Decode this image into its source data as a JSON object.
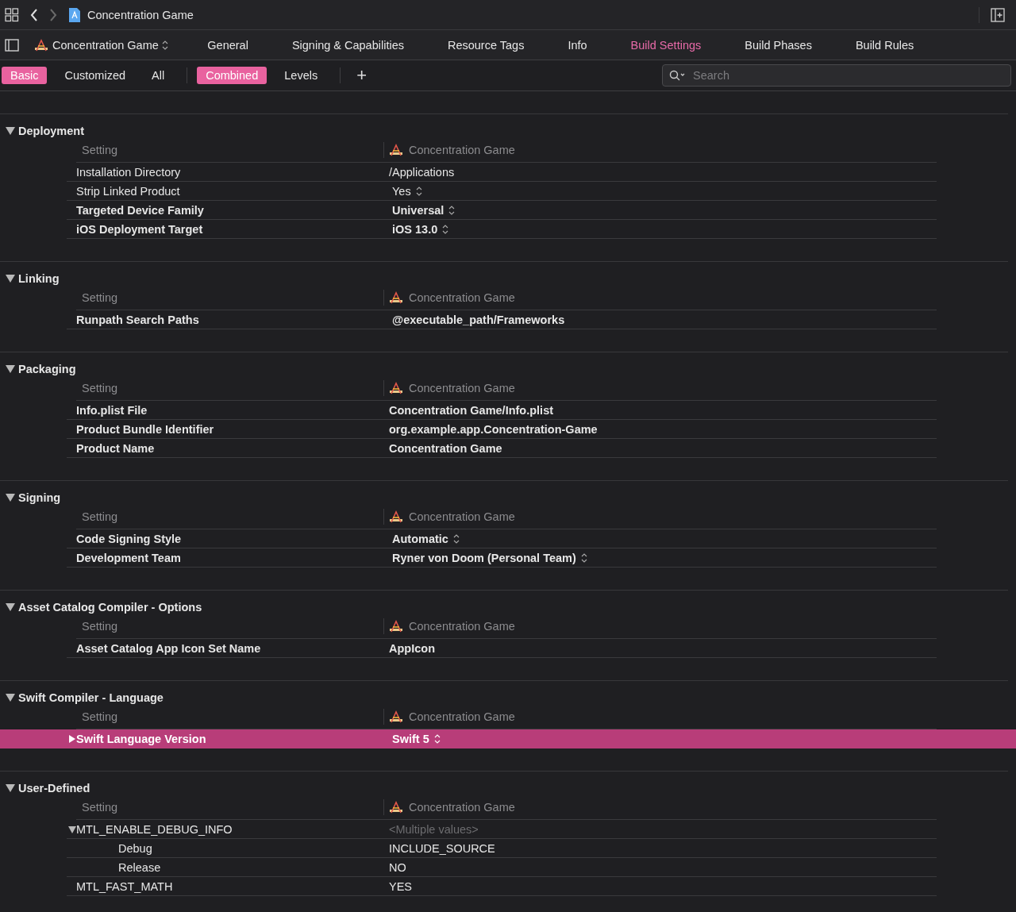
{
  "toolbar": {
    "title": "Concentration Game"
  },
  "editor_tabs": {
    "target": "Concentration Game",
    "tabs": [
      {
        "label": "General",
        "selected": false
      },
      {
        "label": "Signing & Capabilities",
        "selected": false
      },
      {
        "label": "Resource Tags",
        "selected": false
      },
      {
        "label": "Info",
        "selected": false
      },
      {
        "label": "Build Settings",
        "selected": true
      },
      {
        "label": "Build Phases",
        "selected": false
      },
      {
        "label": "Build Rules",
        "selected": false
      }
    ]
  },
  "filter_bar": {
    "scope": [
      {
        "label": "Basic",
        "selected": true
      },
      {
        "label": "Customized",
        "selected": false
      },
      {
        "label": "All",
        "selected": false
      }
    ],
    "view": [
      {
        "label": "Combined",
        "selected": true
      },
      {
        "label": "Levels",
        "selected": false
      }
    ],
    "add": "+",
    "search": {
      "placeholder": "Search"
    }
  },
  "sections": [
    {
      "title": "Deployment",
      "expanded": true,
      "column_setting": "Setting",
      "column_target": "Concentration Game",
      "rows": [
        {
          "setting": "Installation Directory",
          "value": "/Applications",
          "bold": false,
          "popup": false,
          "selected": false,
          "dimmed": false
        },
        {
          "setting": "Strip Linked Product",
          "value": "Yes",
          "bold": false,
          "popup": true,
          "selected": false,
          "dimmed": false
        },
        {
          "setting": "Targeted Device Family",
          "value": "Universal",
          "bold": true,
          "popup": true,
          "selected": false,
          "dimmed": false
        },
        {
          "setting": "iOS Deployment Target",
          "value": "iOS 13.0",
          "bold": true,
          "popup": true,
          "selected": false,
          "dimmed": false
        }
      ]
    },
    {
      "title": "Linking",
      "expanded": true,
      "column_setting": "Setting",
      "column_target": "Concentration Game",
      "rows": [
        {
          "setting": "Runpath Search Paths",
          "value": "@executable_path/Frameworks",
          "bold": true,
          "popup": false,
          "selected": false,
          "dimmed": false,
          "indent_value": true
        }
      ]
    },
    {
      "title": "Packaging",
      "expanded": true,
      "column_setting": "Setting",
      "column_target": "Concentration Game",
      "rows": [
        {
          "setting": "Info.plist File",
          "value": "Concentration Game/Info.plist",
          "bold": true,
          "popup": false,
          "selected": false,
          "dimmed": false
        },
        {
          "setting": "Product Bundle Identifier",
          "value": "org.example.app.Concentration-Game",
          "bold": true,
          "popup": false,
          "selected": false,
          "dimmed": false
        },
        {
          "setting": "Product Name",
          "value": "Concentration Game",
          "bold": true,
          "popup": false,
          "selected": false,
          "dimmed": false
        }
      ]
    },
    {
      "title": "Signing",
      "expanded": true,
      "column_setting": "Setting",
      "column_target": "Concentration Game",
      "rows": [
        {
          "setting": "Code Signing Style",
          "value": "Automatic",
          "bold": true,
          "popup": true,
          "selected": false,
          "dimmed": false
        },
        {
          "setting": "Development Team",
          "value": "Ryner von Doom (Personal Team)",
          "bold": true,
          "popup": true,
          "selected": false,
          "dimmed": false
        }
      ]
    },
    {
      "title": "Asset Catalog Compiler - Options",
      "expanded": true,
      "column_setting": "Setting",
      "column_target": "Concentration Game",
      "rows": [
        {
          "setting": "Asset Catalog App Icon Set Name",
          "value": "AppIcon",
          "bold": true,
          "popup": false,
          "selected": false,
          "dimmed": false
        }
      ]
    },
    {
      "title": "Swift Compiler - Language",
      "expanded": true,
      "column_setting": "Setting",
      "column_target": "Concentration Game",
      "rows": [
        {
          "setting": "Swift Language Version",
          "value": "Swift 5",
          "bold": true,
          "popup": true,
          "selected": true,
          "dimmed": false,
          "expanded": false
        }
      ]
    },
    {
      "title": "User-Defined",
      "expanded": true,
      "column_setting": "Setting",
      "column_target": "Concentration Game",
      "rows": [
        {
          "setting": "MTL_ENABLE_DEBUG_INFO",
          "value": "<Multiple values>",
          "bold": false,
          "popup": false,
          "selected": false,
          "dimmed": true,
          "expanded": true,
          "children": [
            {
              "setting": "Debug",
              "value": "INCLUDE_SOURCE",
              "bold": false,
              "popup": false,
              "selected": false,
              "dimmed": false
            },
            {
              "setting": "Release",
              "value": "NO",
              "bold": false,
              "popup": false,
              "selected": false,
              "dimmed": false
            }
          ]
        },
        {
          "setting": "MTL_FAST_MATH",
          "value": "YES",
          "bold": false,
          "popup": false,
          "selected": false,
          "dimmed": false
        }
      ]
    }
  ]
}
